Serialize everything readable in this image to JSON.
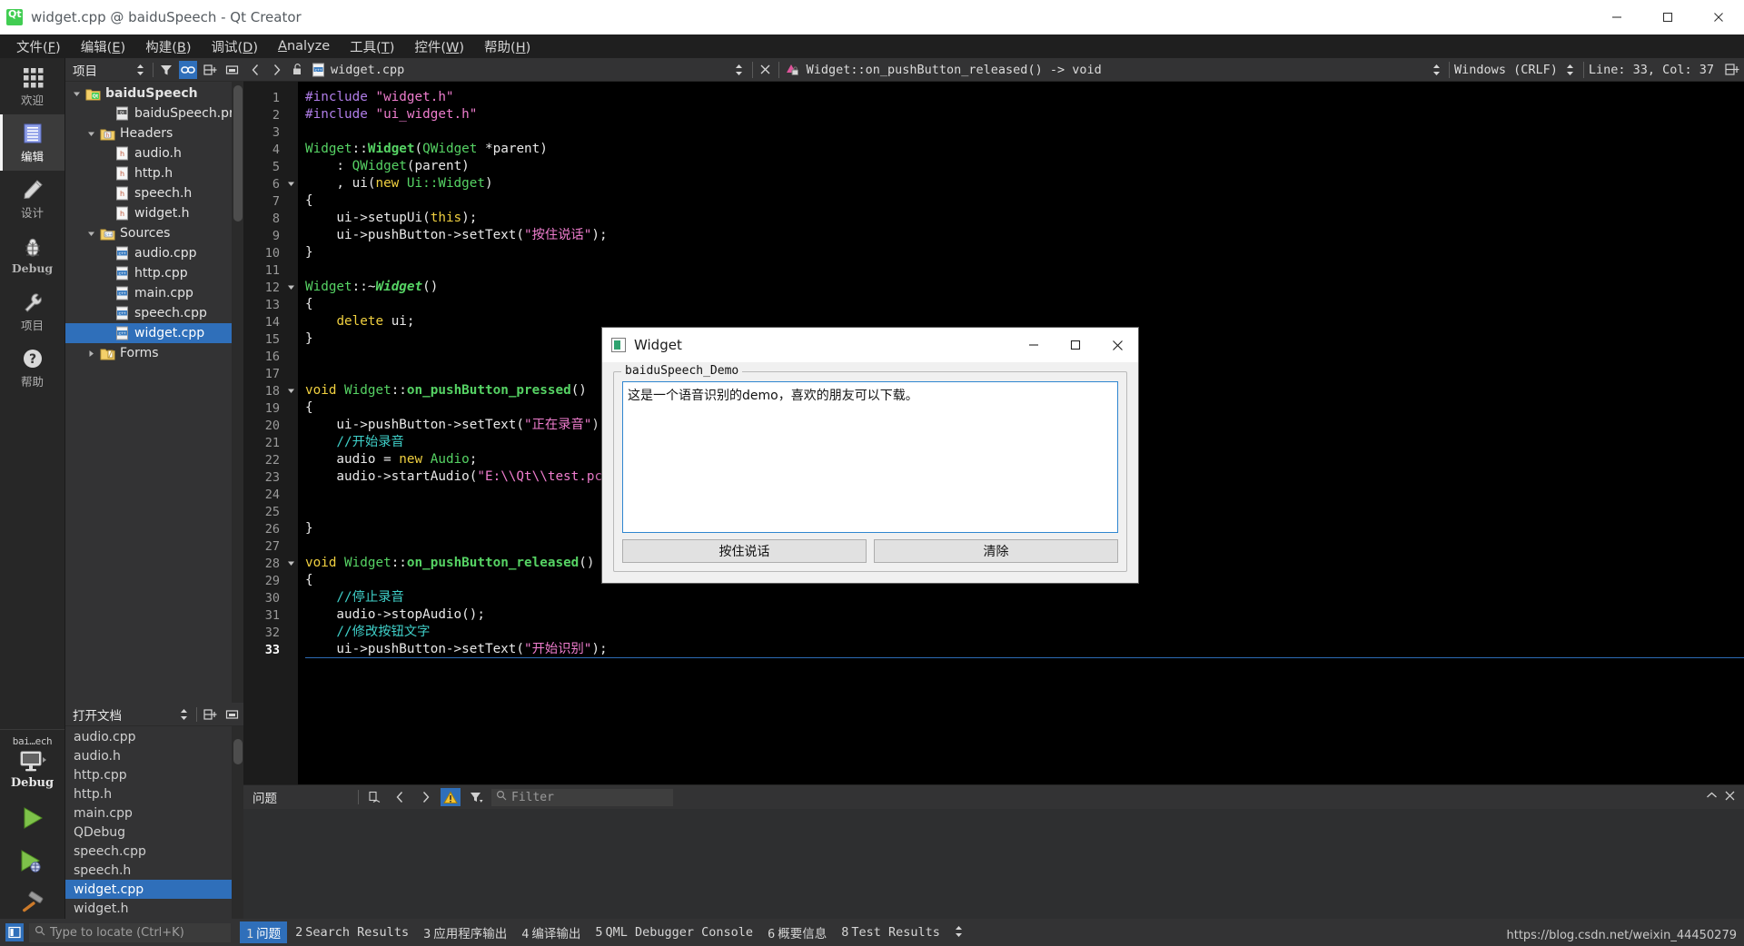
{
  "window": {
    "title": "widget.cpp @ baiduSpeech - Qt Creator",
    "logo_icon": "qt-logo-icon",
    "minimize_icon": "minimize-icon",
    "maximize_icon": "maximize-icon",
    "close_icon": "close-icon"
  },
  "menubar": {
    "items": [
      {
        "label": "文件(F)",
        "mnemonic": "F"
      },
      {
        "label": "编辑(E)",
        "mnemonic": "E"
      },
      {
        "label": "构建(B)",
        "mnemonic": "B"
      },
      {
        "label": "调试(D)",
        "mnemonic": "D"
      },
      {
        "label": "Analyze",
        "mnemonic": "A"
      },
      {
        "label": "工具(T)",
        "mnemonic": "T"
      },
      {
        "label": "控件(W)",
        "mnemonic": "W"
      },
      {
        "label": "帮助(H)",
        "mnemonic": "H"
      }
    ]
  },
  "modebar": {
    "modes": [
      {
        "label": "欢迎",
        "icon": "grid-icon",
        "active": false
      },
      {
        "label": "编辑",
        "icon": "document-icon",
        "active": true
      },
      {
        "label": "设计",
        "icon": "pencil-icon",
        "active": false
      },
      {
        "label": "Debug",
        "icon": "bug-icon",
        "active": false
      },
      {
        "label": "项目",
        "icon": "wrench-icon",
        "active": false
      },
      {
        "label": "帮助",
        "icon": "question-icon",
        "active": false
      }
    ],
    "kit": {
      "project_name": "bai…ech",
      "target_icon": "desktop-icon",
      "build_config": "Debug",
      "expand_icon": "chevron-right-icon"
    },
    "run_buttons": [
      {
        "name": "run-button",
        "icon": "play-icon"
      },
      {
        "name": "debug-button",
        "icon": "play-bug-icon"
      },
      {
        "name": "build-button",
        "icon": "hammer-icon"
      }
    ]
  },
  "project_dock": {
    "title": "项目",
    "buttons": [
      {
        "name": "view-selector",
        "icon": "updown-icon",
        "active": false
      },
      {
        "name": "filter-button",
        "icon": "funnel-icon",
        "active": false
      },
      {
        "name": "sync-selection-button",
        "icon": "link-icon",
        "active": true
      },
      {
        "name": "split-button",
        "icon": "split-icon",
        "active": false
      },
      {
        "name": "close-dock-button",
        "icon": "minimize-dock-icon",
        "active": false
      }
    ],
    "tree": [
      {
        "label": "baiduSpeech",
        "icon": "qt-project-icon",
        "depth": 0,
        "expander": "down",
        "bold": true,
        "selected": false
      },
      {
        "label": "baiduSpeech.pro",
        "icon": "pro-file-icon",
        "depth": 2,
        "expander": "",
        "bold": false,
        "selected": false
      },
      {
        "label": "Headers",
        "icon": "folder-h-icon",
        "depth": 1,
        "expander": "down",
        "bold": false,
        "selected": false
      },
      {
        "label": "audio.h",
        "icon": "h-file-icon",
        "depth": 2,
        "expander": "",
        "bold": false,
        "selected": false
      },
      {
        "label": "http.h",
        "icon": "h-file-icon",
        "depth": 2,
        "expander": "",
        "bold": false,
        "selected": false
      },
      {
        "label": "speech.h",
        "icon": "h-file-icon",
        "depth": 2,
        "expander": "",
        "bold": false,
        "selected": false
      },
      {
        "label": "widget.h",
        "icon": "h-file-icon",
        "depth": 2,
        "expander": "",
        "bold": false,
        "selected": false
      },
      {
        "label": "Sources",
        "icon": "folder-cpp-icon",
        "depth": 1,
        "expander": "down",
        "bold": false,
        "selected": false
      },
      {
        "label": "audio.cpp",
        "icon": "cpp-file-icon",
        "depth": 2,
        "expander": "",
        "bold": false,
        "selected": false
      },
      {
        "label": "http.cpp",
        "icon": "cpp-file-icon",
        "depth": 2,
        "expander": "",
        "bold": false,
        "selected": false
      },
      {
        "label": "main.cpp",
        "icon": "cpp-file-icon",
        "depth": 2,
        "expander": "",
        "bold": false,
        "selected": false
      },
      {
        "label": "speech.cpp",
        "icon": "cpp-file-icon",
        "depth": 2,
        "expander": "",
        "bold": false,
        "selected": false
      },
      {
        "label": "widget.cpp",
        "icon": "cpp-file-icon",
        "depth": 2,
        "expander": "",
        "bold": false,
        "selected": true
      },
      {
        "label": "Forms",
        "icon": "folder-ui-icon",
        "depth": 1,
        "expander": "right",
        "bold": false,
        "selected": false
      }
    ]
  },
  "open_documents": {
    "title": "打开文档",
    "buttons": [
      {
        "name": "opendocs-view-selector",
        "icon": "updown-icon"
      },
      {
        "name": "opendocs-split-button",
        "icon": "split-icon"
      },
      {
        "name": "opendocs-close-button",
        "icon": "minimize-dock-icon"
      }
    ],
    "items": [
      {
        "label": "audio.cpp",
        "selected": false
      },
      {
        "label": "audio.h",
        "selected": false
      },
      {
        "label": "http.cpp",
        "selected": false
      },
      {
        "label": "http.h",
        "selected": false
      },
      {
        "label": "main.cpp",
        "selected": false
      },
      {
        "label": "QDebug",
        "selected": false
      },
      {
        "label": "speech.cpp",
        "selected": false
      },
      {
        "label": "speech.h",
        "selected": false
      },
      {
        "label": "widget.cpp",
        "selected": true
      },
      {
        "label": "widget.h",
        "selected": false
      }
    ]
  },
  "editor_toolbar": {
    "back_icon": "chevron-left-icon",
    "forward_icon": "chevron-right-icon",
    "lock_icon": "unlocked-icon",
    "file_icon": "cpp-file-icon",
    "file_name": "widget.cpp",
    "file_dropdown_icon": "updown-icon",
    "close_icon": "close-icon",
    "symbol_icon": "method-private-icon",
    "symbol_name": "Widget::on_pushButton_released() -> void",
    "symbol_dropdown_icon": "updown-icon",
    "line_ending": "Windows (CRLF)",
    "line_ending_dropdown_icon": "updown-icon",
    "cursor_position": "Line: 33, Col: 37",
    "split_icon": "split-add-icon"
  },
  "code": {
    "current_line": 33,
    "lines": [
      {
        "n": 1,
        "fold": "",
        "tokens": [
          {
            "t": "#include ",
            "c": "pre"
          },
          {
            "t": "\"widget.h\"",
            "c": "str"
          }
        ]
      },
      {
        "n": 2,
        "fold": "",
        "tokens": [
          {
            "t": "#include ",
            "c": "pre"
          },
          {
            "t": "\"ui_widget.h\"",
            "c": "str"
          }
        ]
      },
      {
        "n": 3,
        "fold": "",
        "tokens": []
      },
      {
        "n": 4,
        "fold": "",
        "tokens": [
          {
            "t": "Widget",
            "c": "type"
          },
          {
            "t": "::",
            "c": "plain"
          },
          {
            "t": "Widget",
            "c": "fn"
          },
          {
            "t": "(",
            "c": "plain"
          },
          {
            "t": "QWidget",
            "c": "type"
          },
          {
            "t": " *parent)",
            "c": "plain"
          }
        ]
      },
      {
        "n": 5,
        "fold": "",
        "tokens": [
          {
            "t": "    : ",
            "c": "plain"
          },
          {
            "t": "QWidget",
            "c": "type"
          },
          {
            "t": "(parent)",
            "c": "plain"
          }
        ]
      },
      {
        "n": 6,
        "fold": "down",
        "tokens": [
          {
            "t": "    , ui(",
            "c": "plain"
          },
          {
            "t": "new",
            "c": "kw"
          },
          {
            "t": " ",
            "c": "plain"
          },
          {
            "t": "Ui::Widget",
            "c": "type"
          },
          {
            "t": ")",
            "c": "plain"
          }
        ]
      },
      {
        "n": 7,
        "fold": "",
        "tokens": [
          {
            "t": "{",
            "c": "plain"
          }
        ]
      },
      {
        "n": 8,
        "fold": "",
        "tokens": [
          {
            "t": "    ui->setupUi(",
            "c": "plain"
          },
          {
            "t": "this",
            "c": "kw"
          },
          {
            "t": ");",
            "c": "plain"
          }
        ]
      },
      {
        "n": 9,
        "fold": "",
        "tokens": [
          {
            "t": "    ui->pushButton->setText(",
            "c": "plain"
          },
          {
            "t": "\"按住说话\"",
            "c": "str"
          },
          {
            "t": ");",
            "c": "plain"
          }
        ]
      },
      {
        "n": 10,
        "fold": "",
        "tokens": [
          {
            "t": "}",
            "c": "plain"
          }
        ]
      },
      {
        "n": 11,
        "fold": "",
        "tokens": []
      },
      {
        "n": 12,
        "fold": "down",
        "tokens": [
          {
            "t": "Widget",
            "c": "type"
          },
          {
            "t": "::~",
            "c": "plain"
          },
          {
            "t": "Widget",
            "c": "it"
          },
          {
            "t": "()",
            "c": "plain"
          }
        ]
      },
      {
        "n": 13,
        "fold": "",
        "tokens": [
          {
            "t": "{",
            "c": "plain"
          }
        ]
      },
      {
        "n": 14,
        "fold": "",
        "tokens": [
          {
            "t": "    ",
            "c": "plain"
          },
          {
            "t": "delete",
            "c": "kw"
          },
          {
            "t": " ui;",
            "c": "plain"
          }
        ]
      },
      {
        "n": 15,
        "fold": "",
        "tokens": [
          {
            "t": "}",
            "c": "plain"
          }
        ]
      },
      {
        "n": 16,
        "fold": "",
        "tokens": []
      },
      {
        "n": 17,
        "fold": "",
        "tokens": []
      },
      {
        "n": 18,
        "fold": "down",
        "tokens": [
          {
            "t": "void",
            "c": "kw"
          },
          {
            "t": " ",
            "c": "plain"
          },
          {
            "t": "Widget",
            "c": "type"
          },
          {
            "t": "::",
            "c": "plain"
          },
          {
            "t": "on_pushButton_pressed",
            "c": "fn"
          },
          {
            "t": "()",
            "c": "plain"
          }
        ]
      },
      {
        "n": 19,
        "fold": "",
        "tokens": [
          {
            "t": "{",
            "c": "plain"
          }
        ]
      },
      {
        "n": 20,
        "fold": "",
        "tokens": [
          {
            "t": "    ui->pushButton->setText(",
            "c": "plain"
          },
          {
            "t": "\"正在录音\"",
            "c": "str"
          },
          {
            "t": ");",
            "c": "plain"
          }
        ]
      },
      {
        "n": 21,
        "fold": "",
        "tokens": [
          {
            "t": "    //开始录音",
            "c": "cmt"
          }
        ]
      },
      {
        "n": 22,
        "fold": "",
        "tokens": [
          {
            "t": "    audio = ",
            "c": "plain"
          },
          {
            "t": "new",
            "c": "kw"
          },
          {
            "t": " ",
            "c": "plain"
          },
          {
            "t": "Audio",
            "c": "type"
          },
          {
            "t": ";",
            "c": "plain"
          }
        ]
      },
      {
        "n": 23,
        "fold": "",
        "tokens": [
          {
            "t": "    audio->startAudio(",
            "c": "plain"
          },
          {
            "t": "\"E:\\\\Qt\\\\test.pcm\"",
            "c": "str"
          },
          {
            "t": ");",
            "c": "plain"
          }
        ]
      },
      {
        "n": 24,
        "fold": "",
        "tokens": []
      },
      {
        "n": 25,
        "fold": "",
        "tokens": []
      },
      {
        "n": 26,
        "fold": "",
        "tokens": [
          {
            "t": "}",
            "c": "plain"
          }
        ]
      },
      {
        "n": 27,
        "fold": "",
        "tokens": []
      },
      {
        "n": 28,
        "fold": "down",
        "tokens": [
          {
            "t": "void",
            "c": "kw"
          },
          {
            "t": " ",
            "c": "plain"
          },
          {
            "t": "Widget",
            "c": "type"
          },
          {
            "t": "::",
            "c": "plain"
          },
          {
            "t": "on_pushButton_released",
            "c": "fn"
          },
          {
            "t": "()",
            "c": "plain"
          }
        ]
      },
      {
        "n": 29,
        "fold": "",
        "tokens": [
          {
            "t": "{",
            "c": "plain"
          }
        ]
      },
      {
        "n": 30,
        "fold": "",
        "tokens": [
          {
            "t": "    //停止录音",
            "c": "cmt"
          }
        ]
      },
      {
        "n": 31,
        "fold": "",
        "tokens": [
          {
            "t": "    audio->stopAudio();",
            "c": "plain"
          }
        ]
      },
      {
        "n": 32,
        "fold": "",
        "tokens": [
          {
            "t": "    //修改按钮文字",
            "c": "cmt"
          }
        ]
      },
      {
        "n": 33,
        "fold": "",
        "tokens": [
          {
            "t": "    ui->pushButton->setText(",
            "c": "plain"
          },
          {
            "t": "\"开始识别\"",
            "c": "str"
          },
          {
            "t": ");",
            "c": "plain"
          }
        ]
      }
    ]
  },
  "issues_pane": {
    "title": "问题",
    "buttons": [
      {
        "name": "copy-issues-button",
        "icon": "copy-icon",
        "active": false
      },
      {
        "name": "previous-issue-button",
        "icon": "chevron-left-icon",
        "active": false
      },
      {
        "name": "next-issue-button",
        "icon": "chevron-right-icon",
        "active": false
      },
      {
        "name": "warning-filter-button",
        "icon": "warning-triangle-icon",
        "active": true
      },
      {
        "name": "filter-dropdown-button",
        "icon": "funnel-icon",
        "active": false
      }
    ],
    "filter_placeholder": "Filter",
    "filter_value": "",
    "filter_icon": "search-icon",
    "maximize_icon": "chevron-up-icon",
    "close_icon": "close-icon"
  },
  "statusbar": {
    "sidebar_toggle_icon": "sidebar-toggle-icon",
    "locator_icon": "search-icon",
    "locator_placeholder": "Type to locate (Ctrl+K)",
    "locator_value": "",
    "tabs": [
      {
        "num": "1",
        "label": "问题",
        "active": true
      },
      {
        "num": "2",
        "label": "Search Results",
        "active": false
      },
      {
        "num": "3",
        "label": "应用程序输出",
        "active": false
      },
      {
        "num": "4",
        "label": "编译输出",
        "active": false
      },
      {
        "num": "5",
        "label": "QML Debugger Console",
        "active": false
      },
      {
        "num": "6",
        "label": "概要信息",
        "active": false
      },
      {
        "num": "8",
        "label": "Test Results",
        "active": false
      }
    ],
    "more_icon": "updown-icon",
    "watermark": "https://blog.csdn.net/weixin_44450279"
  },
  "dialog": {
    "icon": "widget-app-icon",
    "title": "Widget",
    "minimize_icon": "minimize-icon",
    "maximize_icon": "maximize-icon",
    "close_icon": "close-icon",
    "groupbox_legend": "baiduSpeech_Demo",
    "textedit_value": "这是一个语音识别的demo，喜欢的朋友可以下载。",
    "buttons": [
      {
        "label": "按住说话",
        "name": "push-to-talk-button"
      },
      {
        "label": "清除",
        "name": "clear-button"
      }
    ]
  }
}
